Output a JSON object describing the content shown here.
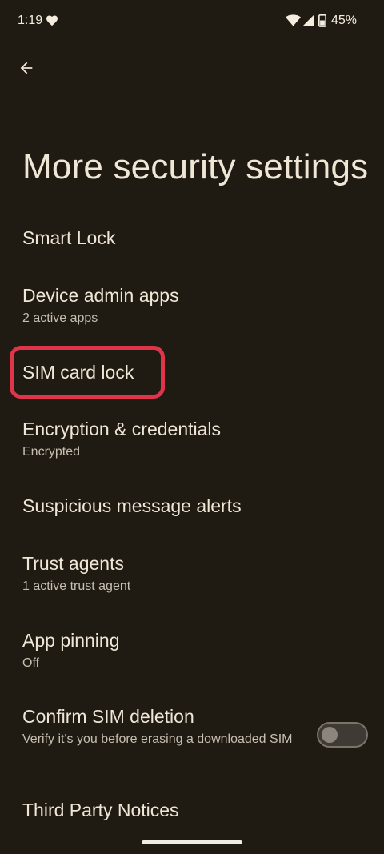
{
  "status_bar": {
    "time": "1:19",
    "battery": "45%"
  },
  "page": {
    "title": "More security settings"
  },
  "items": [
    {
      "title": "Smart Lock",
      "subtitle": ""
    },
    {
      "title": "Device admin apps",
      "subtitle": "2 active apps"
    },
    {
      "title": "SIM card lock",
      "subtitle": ""
    },
    {
      "title": "Encryption & credentials",
      "subtitle": "Encrypted"
    },
    {
      "title": "Suspicious message alerts",
      "subtitle": ""
    },
    {
      "title": "Trust agents",
      "subtitle": "1 active trust agent"
    },
    {
      "title": "App pinning",
      "subtitle": "Off"
    },
    {
      "title": "Confirm SIM deletion",
      "subtitle": "Verify it's you before erasing a downloaded SIM",
      "toggle_on": false
    },
    {
      "title": "Third Party Notices",
      "subtitle": ""
    }
  ],
  "colors": {
    "background": "#1f1a12",
    "text": "#efe6d6",
    "highlight": "#e0344a"
  },
  "icons": [
    "heart-icon",
    "wifi-icon",
    "signal-icon",
    "battery-icon",
    "arrow-back-icon"
  ]
}
